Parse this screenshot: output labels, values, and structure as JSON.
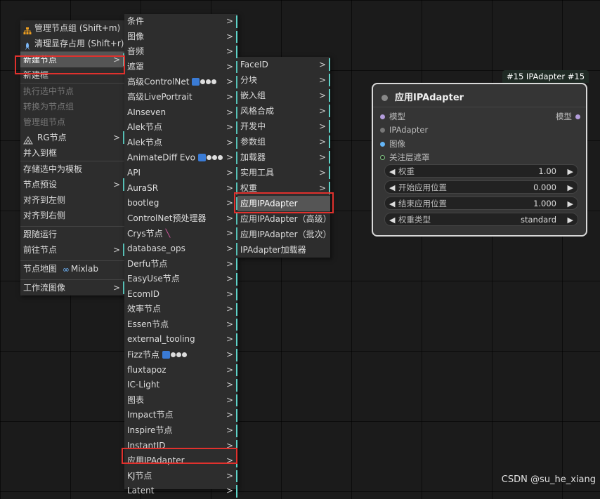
{
  "menu1": {
    "items": [
      {
        "label": "管理节点组 (Shift+m)",
        "icon": "node-group-icon"
      },
      {
        "label": "清理显存占用 (Shift+r)",
        "icon": "rocket-icon"
      },
      {
        "label": "新建节点",
        "arrow": ">"
      },
      {
        "label": "新建框"
      },
      {
        "label": "执行选中节点"
      },
      {
        "label": "转换为节点组"
      },
      {
        "label": "管理组节点"
      },
      {
        "label": "RG节点",
        "icon": "rg-icon",
        "arrow": ">"
      },
      {
        "label": "并入到框"
      },
      {
        "label": "存储选中为模板"
      },
      {
        "label": "节点预设",
        "arrow": ">"
      },
      {
        "label": "对齐到左侧"
      },
      {
        "label": "对齐到右侧"
      },
      {
        "label": "跟随运行"
      },
      {
        "label": "前往节点",
        "arrow": ">"
      },
      {
        "label": "节点地图",
        "suffix": "Mixlab",
        "icon": "infinity-icon"
      },
      {
        "label": "工作流图像",
        "arrow": ">"
      }
    ]
  },
  "menu2": {
    "items": [
      "条件",
      "图像",
      "音频",
      "遮罩",
      "高级ControlNet",
      "高级LivePortrait",
      "AInseven",
      "Alek节点",
      "Alek节点",
      "AnimateDiff Evo",
      "API",
      "AuraSR",
      "bootleg",
      "ControlNet预处理器",
      "Crys节点",
      "database_ops",
      "Derfu节点",
      "EasyUse节点",
      "EcomID",
      "效率节点",
      "Essen节点",
      "external_tooling",
      "Fizz节点",
      "fluxtapoz",
      "IC-Light",
      "图表",
      "Impact节点",
      "Inspire节点",
      "InstantID",
      "应用IPAdapter",
      "KJ节点",
      "Latent"
    ],
    "arrow": ">"
  },
  "menu3": {
    "items": [
      {
        "label": "FaceID",
        "arrow": ">"
      },
      {
        "label": "分块",
        "arrow": ">"
      },
      {
        "label": "嵌入组",
        "arrow": ">"
      },
      {
        "label": "风格合成",
        "arrow": ">"
      },
      {
        "label": "开发中",
        "arrow": ">"
      },
      {
        "label": "参数组",
        "arrow": ">"
      },
      {
        "label": "加载器",
        "arrow": ">"
      },
      {
        "label": "实用工具",
        "arrow": ">"
      },
      {
        "label": "权重",
        "arrow": ">"
      },
      {
        "label": "应用IPAdapter"
      },
      {
        "label": "应用IPAdapter（高级）"
      },
      {
        "label": "应用IPAdapter（批次）"
      },
      {
        "label": "IPAdapter加载器"
      }
    ]
  },
  "node": {
    "badge": "#15 IPAdapter  #15",
    "title": "应用IPAdapter",
    "inputs": [
      "模型",
      "IPAdapter",
      "图像",
      "关注层遮罩"
    ],
    "output": "模型",
    "widgets": [
      {
        "label": "权重",
        "value": "1.00"
      },
      {
        "label": "开始应用位置",
        "value": "0.000"
      },
      {
        "label": "结束应用位置",
        "value": "1.000"
      },
      {
        "label": "权重类型",
        "value": "standard"
      }
    ]
  },
  "watermark": "CSDN @su_he_xiang",
  "colors": {
    "highlight": "#e0312d",
    "submenu_marker": "#5fd3c9",
    "background": "#1b1b1b"
  }
}
